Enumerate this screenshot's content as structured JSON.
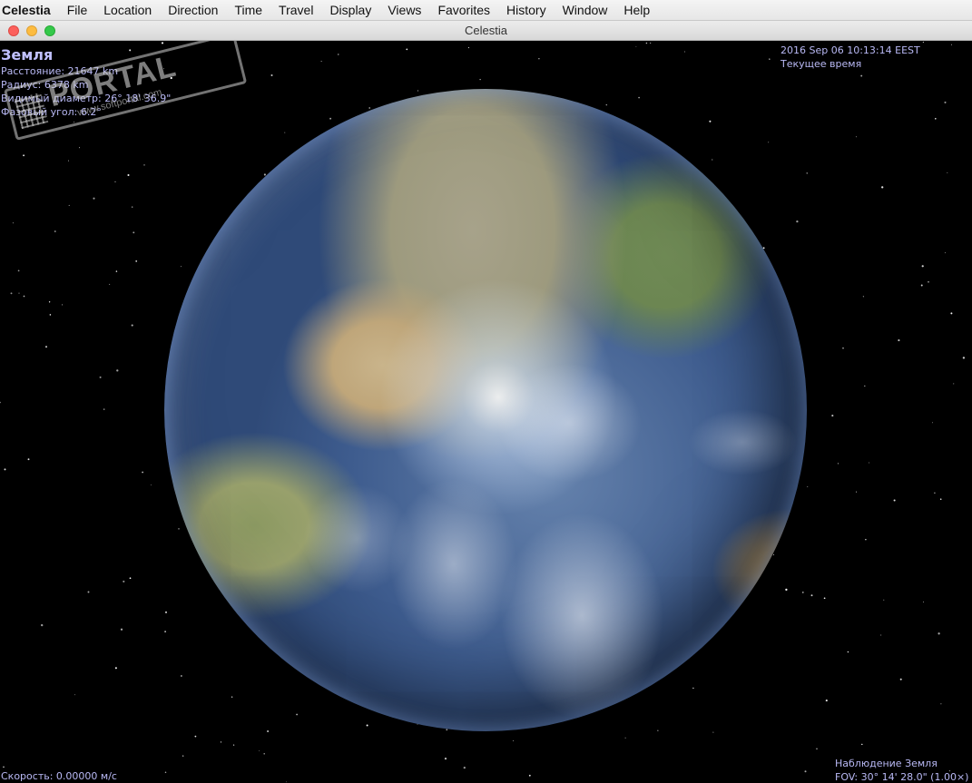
{
  "menubar": {
    "app_name": "Celestia",
    "items": [
      "File",
      "Location",
      "Direction",
      "Time",
      "Travel",
      "Display",
      "Views",
      "Favorites",
      "History",
      "Window",
      "Help"
    ]
  },
  "window": {
    "title": "Celestia"
  },
  "hud": {
    "object_name": "Земля",
    "distance": "Расстояние: 21647 km",
    "radius": "Радиус: 6378 km",
    "apparent_diameter": "Видимый диаметр: 26° 18' 36.9\"",
    "phase_angle": "Фазовый угол: 6.2°",
    "datetime": "2016 Sep 06 10:13:14 EEST",
    "time_mode": "Текущее время",
    "observing": "Наблюдение Земля",
    "fov": "FOV: 30° 14' 28.0\" (1.00×)",
    "speed": "Скорость: 0.00000 м/с"
  },
  "watermark": {
    "text": "PORTAL",
    "url": "www.softportal.com"
  },
  "colors": {
    "hud_text": "#b9b9f5",
    "space": "#000000",
    "close": "#fc605c",
    "minimize": "#fdbc40",
    "zoom": "#34c84a"
  }
}
